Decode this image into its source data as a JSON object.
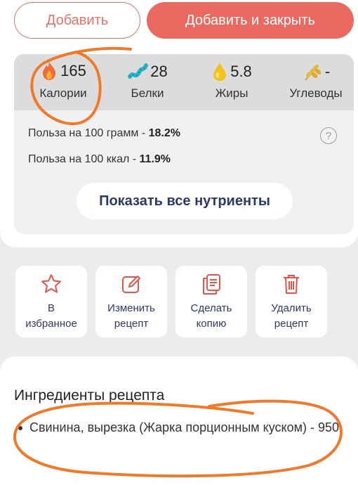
{
  "actions": {
    "add_label": "Добавить",
    "add_close_label": "Добавить и закрыть"
  },
  "macros": [
    {
      "value": "165",
      "label": "Калории",
      "icon": "flame-icon"
    },
    {
      "value": "28",
      "label": "Белки",
      "icon": "protein-icon"
    },
    {
      "value": "5.8",
      "label": "Жиры",
      "icon": "fat-drop-icon"
    },
    {
      "value": "-",
      "label": "Углеводы",
      "icon": "wheat-icon"
    }
  ],
  "benefit": {
    "per_100g_label": "Польза на 100 грамм - ",
    "per_100g_value": "18.2%",
    "per_100kcal_label": "Польза на 100 ккал - ",
    "per_100kcal_value": "11.9%"
  },
  "show_all_label": "Показать все нутриенты",
  "tiles": [
    {
      "line1": "В",
      "line2": "избранное",
      "icon": "star-icon"
    },
    {
      "line1": "Изменить",
      "line2": "рецепт",
      "icon": "edit-icon"
    },
    {
      "line1": "Сделать",
      "line2": "копию",
      "icon": "copy-icon"
    },
    {
      "line1": "Удалить",
      "line2": "рецепт",
      "icon": "trash-icon"
    }
  ],
  "ingredients": {
    "title": "Ингредиенты рецепта",
    "items": [
      "Свинина, вырезка (Жарка порционным куском) - 950"
    ]
  },
  "colors": {
    "accent": "#ea6a61",
    "navy": "#2c3a66",
    "scribble": "#f07a2a"
  }
}
